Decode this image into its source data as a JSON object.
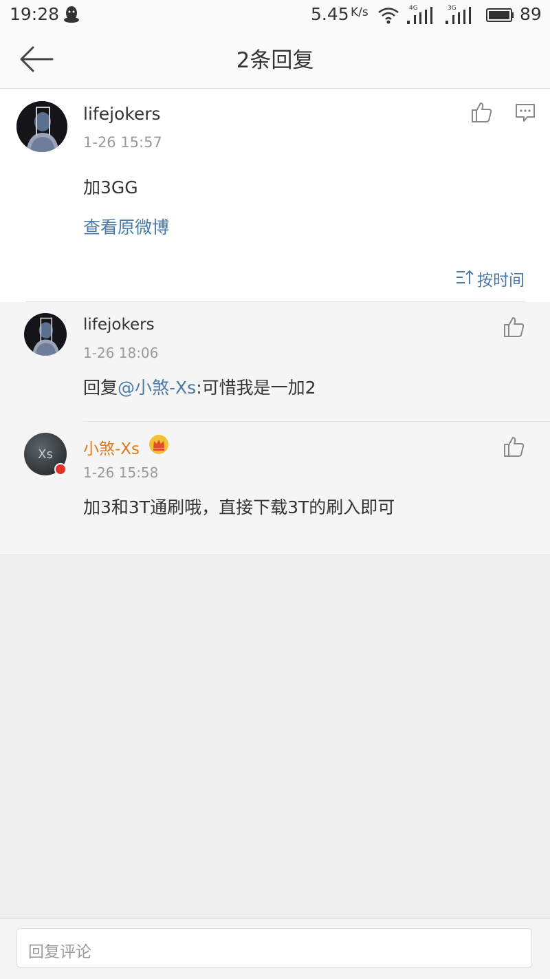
{
  "status_bar": {
    "time": "19:28",
    "net_speed": "5.45",
    "speed_unit": "K/s",
    "sim1_tag": "4G",
    "sim2_tag": "3G",
    "battery": "89",
    "icons": [
      "qq-icon",
      "wifi-icon",
      "signal-icon",
      "battery-icon"
    ]
  },
  "header": {
    "title": "2条回复",
    "back_icon": "arrow-left-icon"
  },
  "main_comment": {
    "username": "lifejokers",
    "timestamp": "1-26 15:57",
    "text": "加3GG",
    "view_original": "查看原微博",
    "sort_label": "按时间"
  },
  "replies": [
    {
      "username": "lifejokers",
      "timestamp": "1-26 18:06",
      "prefix": "回复",
      "mention": "@小煞-Xs",
      "text": ":可惜我是一加2"
    },
    {
      "username": "小煞-Xs",
      "avatar_text": "Xs",
      "timestamp": "1-26 15:58",
      "text": "加3和3T通刷哦，直接下载3T的刷入即可"
    }
  ],
  "footer": {
    "placeholder": "回复评论"
  },
  "colors": {
    "link": "#4a7aa8",
    "vip_username": "#e07a1c",
    "meta": "#9a9a9a"
  }
}
